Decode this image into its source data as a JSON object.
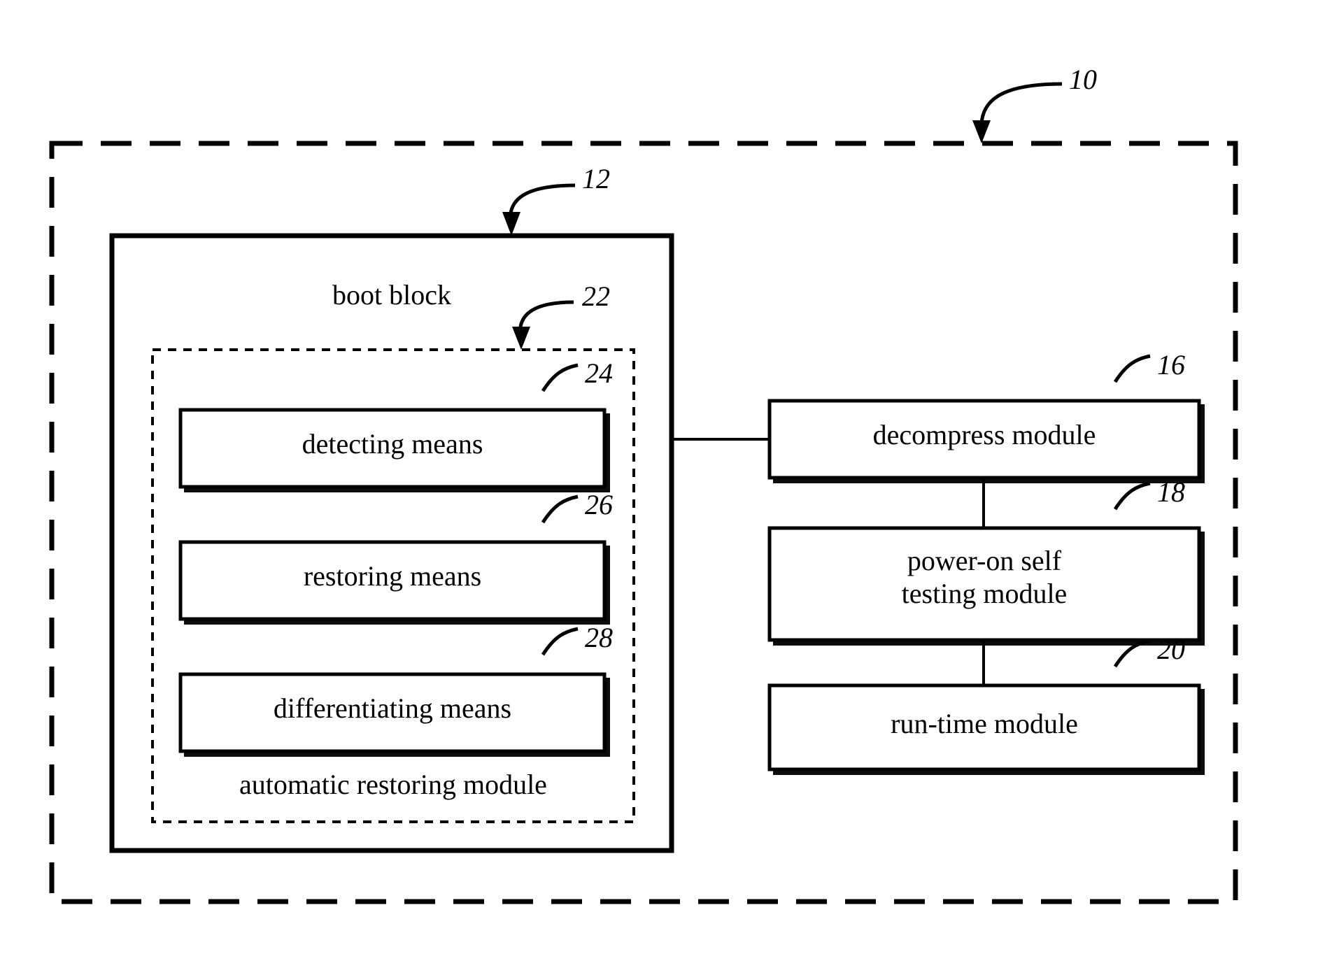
{
  "figure": {
    "type": "block-diagram",
    "system_ref": "10",
    "nodes": [
      {
        "id": "boot_block",
        "label": "boot block",
        "ref": "12"
      },
      {
        "id": "automatic_restoring_module",
        "label": "automatic restoring module",
        "ref": "22"
      },
      {
        "id": "detecting_means",
        "label": "detecting means",
        "ref": "24"
      },
      {
        "id": "restoring_means",
        "label": "restoring means",
        "ref": "26"
      },
      {
        "id": "differentiating_means",
        "label": "differentiating means",
        "ref": "28"
      },
      {
        "id": "decompress_module",
        "label": "decompress module",
        "ref": "16"
      },
      {
        "id": "power_on_self_testing_module",
        "label_line1": "power-on self",
        "label_line2": "testing module",
        "ref": "18"
      },
      {
        "id": "run_time_module",
        "label": "run-time module",
        "ref": "20"
      }
    ],
    "connections": [
      {
        "from": "boot_block",
        "to": "decompress_module"
      },
      {
        "from": "decompress_module",
        "to": "power_on_self_testing_module"
      },
      {
        "from": "power_on_self_testing_module",
        "to": "run_time_module"
      }
    ],
    "colors": {
      "stroke": "#000000",
      "background": "#ffffff"
    }
  }
}
